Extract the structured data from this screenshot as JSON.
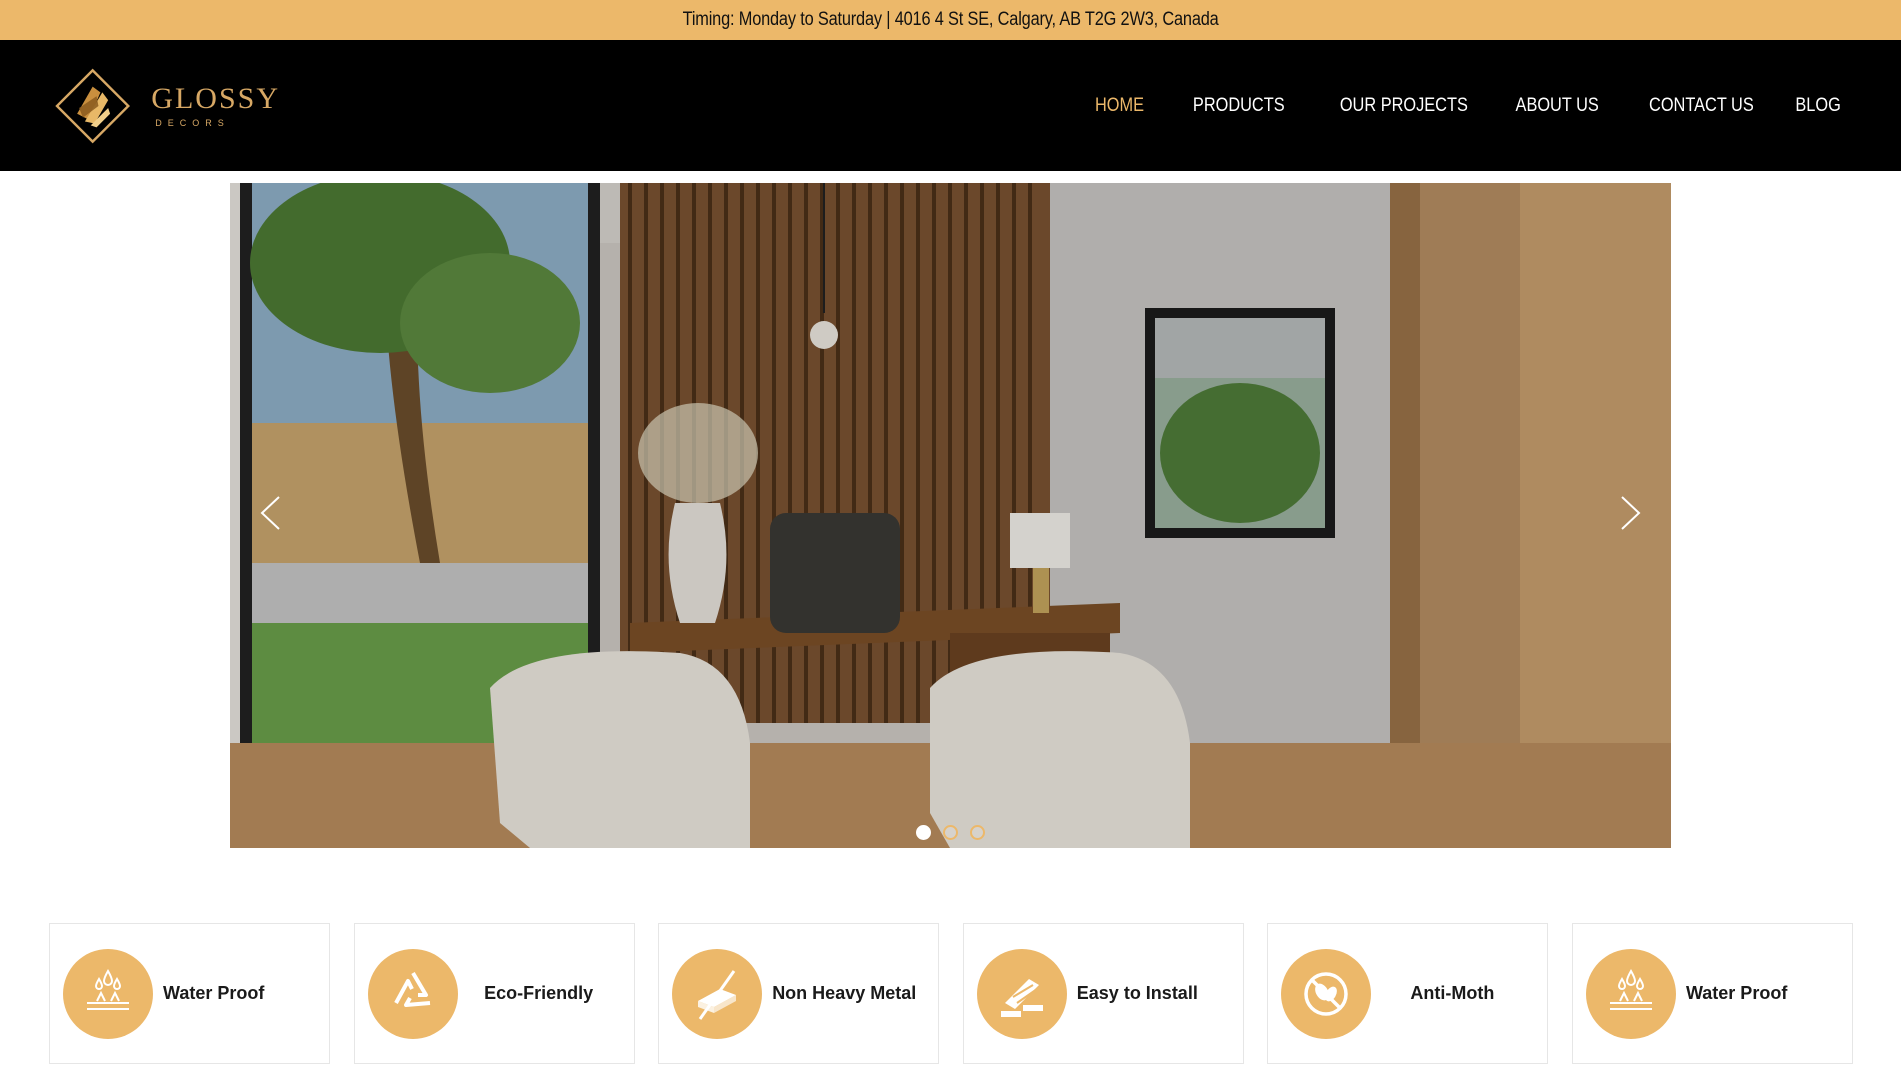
{
  "topbar": {
    "text": "Timing: Monday to Saturday | 4016 4 St SE, Calgary, AB T2G 2W3, Canada"
  },
  "logo": {
    "name": "GLOSSY",
    "sub": "DECORS",
    "icon": "logo-diamond-icon"
  },
  "nav": {
    "items": [
      {
        "label": "HOME",
        "active": true
      },
      {
        "label": "PRODUCTS",
        "active": false
      },
      {
        "label": "OUR PROJECTS",
        "active": false
      },
      {
        "label": "ABOUT US",
        "active": false
      },
      {
        "label": "CONTACT US",
        "active": false
      },
      {
        "label": "BLOG",
        "active": false
      }
    ]
  },
  "slider": {
    "image": "interior-home-office-photo",
    "prev_icon": "chevron-left-icon",
    "next_icon": "chevron-right-icon",
    "slide_count": 3,
    "active_slide": 1
  },
  "features": [
    {
      "label": "Water Proof",
      "icon": "water-drop-icon"
    },
    {
      "label": "Eco-Friendly",
      "icon": "recycle-icon"
    },
    {
      "label": "Non Heavy Metal",
      "icon": "no-metal-icon"
    },
    {
      "label": "Easy to Install",
      "icon": "install-panels-icon"
    },
    {
      "label": "Anti-Moth",
      "icon": "anti-moth-icon"
    },
    {
      "label": "Water Proof",
      "icon": "water-drop-icon"
    }
  ],
  "colors": {
    "accent": "#ecb86a",
    "header_bg": "#000000",
    "active_nav": "#ecb86a"
  }
}
